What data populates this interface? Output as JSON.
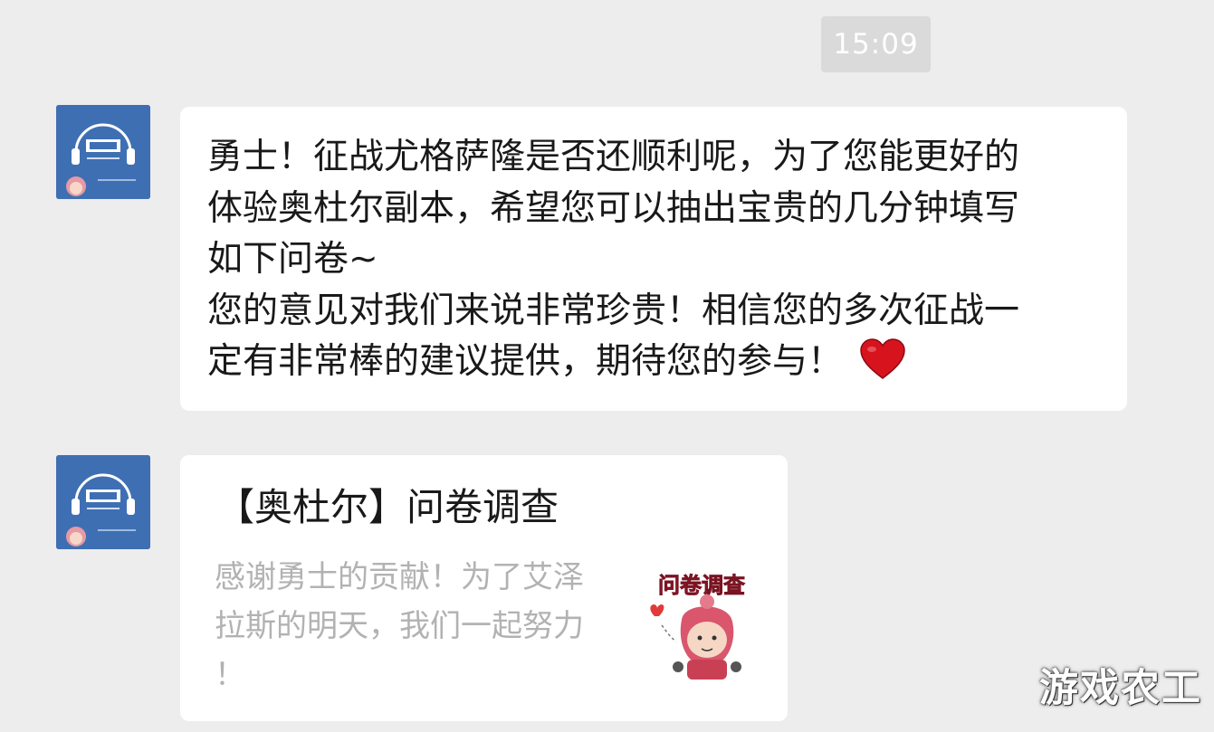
{
  "chat": {
    "timestamp": "15:09",
    "messages": [
      {
        "type": "text",
        "sender_avatar": "official-account-avatar",
        "text": "勇士！征战尤格萨隆是否还顺利呢，为了您能更好的\n体验奥杜尔副本，希望您可以抽出宝贵的几分钟填写\n如下问卷~\n您的意见对我们来说非常珍贵！相信您的多次征战一\n定有非常棒的建议提供，期待您的参与！",
        "trailing_icon": "heart-icon"
      },
      {
        "type": "link_card",
        "sender_avatar": "official-account-avatar",
        "title": "【奥杜尔】问卷调查",
        "description": "感谢勇士的贡献！为了艾泽\n拉斯的明天，我们一起努力\n！",
        "thumbnail_caption": "问卷调查",
        "thumbnail_icon": "survey-mascot-icon"
      }
    ]
  },
  "watermark": "游戏农工",
  "colors": {
    "background": "#ededed",
    "bubble": "#ffffff",
    "avatar": "#3f6fb3",
    "heart": "#d7141e",
    "description_text": "#b2b2b2"
  }
}
